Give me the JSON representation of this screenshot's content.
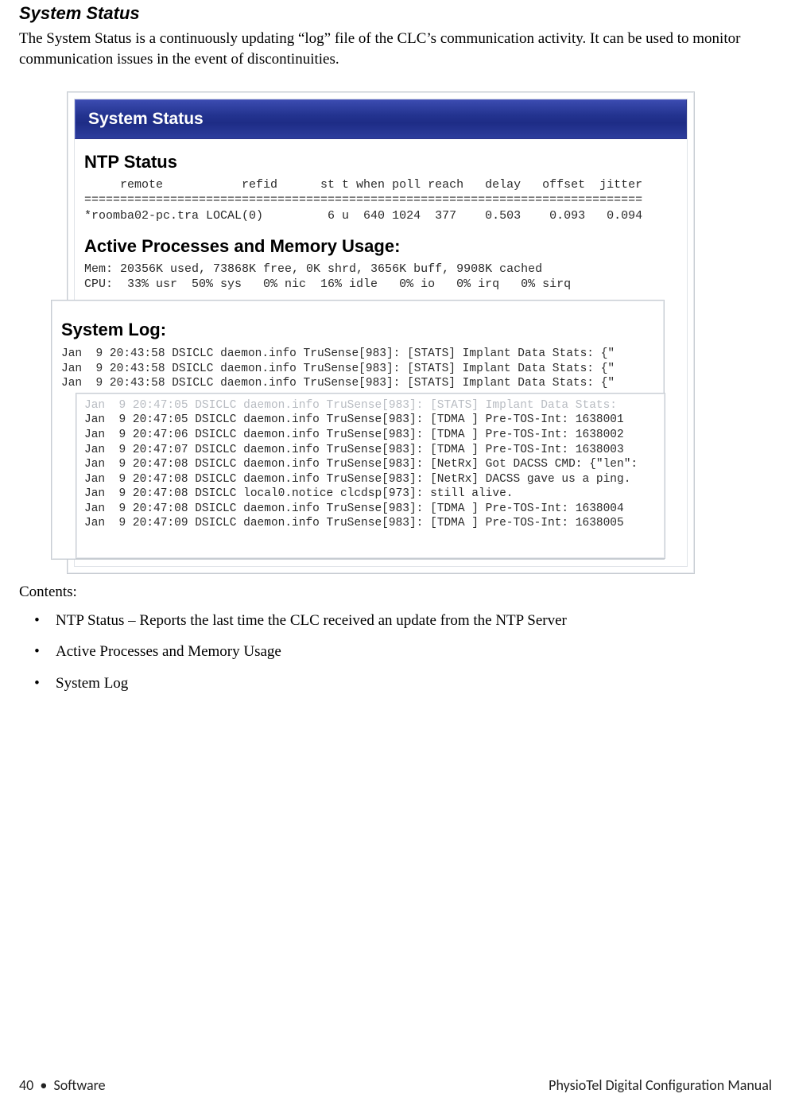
{
  "heading": "System Status",
  "intro": "The System Status is a continuously updating “log” file of the CLC’s communication activity. It can be used to monitor communication issues in the event of discontinuities.",
  "screenshot": {
    "title_bar": "System Status",
    "ntp_heading": "NTP Status",
    "ntp_text": "     remote           refid      st t when poll reach   delay   offset  jitter\n==============================================================================\n*roomba02-pc.tra LOCAL(0)         6 u  640 1024  377    0.503    0.093   0.094",
    "proc_heading": "Active Processes and Memory Usage:",
    "proc_text": "Mem: 20356K used, 73868K free, 0K shrd, 3656K buff, 9908K cached\nCPU:  33% usr  50% sys   0% nic  16% idle   0% io   0% irq   0% sirq",
    "syslog_heading": "System Log:",
    "syslog_lines": "Jan  9 20:43:58 DSICLC daemon.info TruSense[983]: [STATS] Implant Data Stats: {\"\nJan  9 20:43:58 DSICLC daemon.info TruSense[983]: [STATS] Implant Data Stats: {\"\nJan  9 20:43:58 DSICLC daemon.info TruSense[983]: [STATS] Implant Data Stats: {\"",
    "overlay_faint": "Jan  9 20:47:05 DSICLC daemon.info TruSense[983]: [STATS] Implant Data Stats:",
    "overlay_lines": "Jan  9 20:47:05 DSICLC daemon.info TruSense[983]: [TDMA ] Pre-TOS-Int: 1638001\nJan  9 20:47:06 DSICLC daemon.info TruSense[983]: [TDMA ] Pre-TOS-Int: 1638002\nJan  9 20:47:07 DSICLC daemon.info TruSense[983]: [TDMA ] Pre-TOS-Int: 1638003\nJan  9 20:47:08 DSICLC daemon.info TruSense[983]: [NetRx] Got DACSS CMD: {\"len\":\nJan  9 20:47:08 DSICLC daemon.info TruSense[983]: [NetRx] DACSS gave us a ping.\nJan  9 20:47:08 DSICLC local0.notice clcdsp[973]: still alive.\nJan  9 20:47:08 DSICLC daemon.info TruSense[983]: [TDMA ] Pre-TOS-Int: 1638004\nJan  9 20:47:09 DSICLC daemon.info TruSense[983]: [TDMA ] Pre-TOS-Int: 1638005"
  },
  "contents_label": "Contents:",
  "bullets": [
    "NTP Status – Reports the last time the CLC received an update from the NTP Server",
    "Active Processes and Memory Usage",
    "System Log"
  ],
  "footer": {
    "left_page": "40",
    "left_sep": "•",
    "left_section": "Software",
    "right": "PhysioTel Digital Configuration Manual"
  }
}
